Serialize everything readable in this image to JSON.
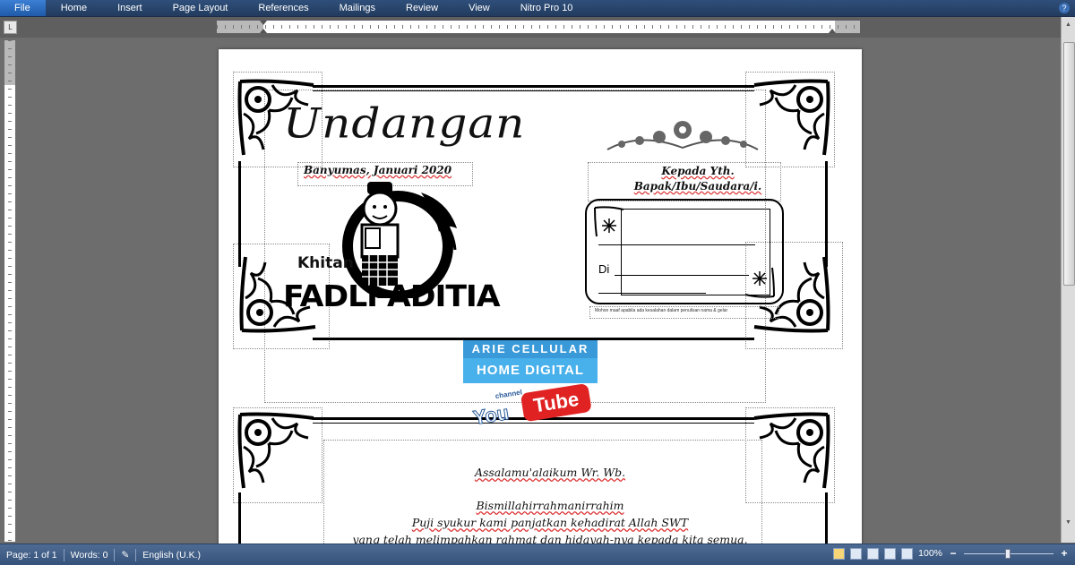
{
  "ribbon": {
    "tabs": [
      "File",
      "Home",
      "Insert",
      "Page Layout",
      "References",
      "Mailings",
      "Review",
      "View",
      "Nitro Pro 10"
    ],
    "help_icon": "question-icon"
  },
  "ruler": {
    "tab_selector": "L"
  },
  "document": {
    "title": "Undangan",
    "date": "Banyumas, Januari 2020",
    "kepada_line1": "Kepada Yth.",
    "kepada_line2": "Bapak/Ibu/Saudara/i.",
    "event": "Khitan",
    "name": "FADLI ADITIA",
    "di_label": "Di",
    "note": "Mohon maaf apabila ada kesalahan dalam penulisan nama & gelar",
    "logo": {
      "line1": "ARIE CELLULAR",
      "line2": "HOME DIGITAL",
      "yt_channel": "channel",
      "yt_you": "You",
      "yt_tube": "Tube"
    },
    "greeting": "Assalamu'alaikum Wr. Wb.",
    "bismillah": "Bismillahirrahmanirrahim",
    "line1": "Puji syukur kami panjatkan kehadirat Allah SWT",
    "line2": "yang telah melimpahkan rahmat dan hidayah-nya kepada kita semua."
  },
  "status": {
    "page": "Page: 1 of 1",
    "words": "Words: 0",
    "language": "English (U.K.)",
    "zoom": "100%",
    "zoom_level_percent": 100,
    "zoom_minus": "−",
    "zoom_plus": "+"
  },
  "colors": {
    "ribbon": "#2f4f7a",
    "file_tab": "#3c7fd4",
    "status": "#4e6b93",
    "logo_blue": "#48b0ea",
    "yt_red": "#e02222"
  }
}
